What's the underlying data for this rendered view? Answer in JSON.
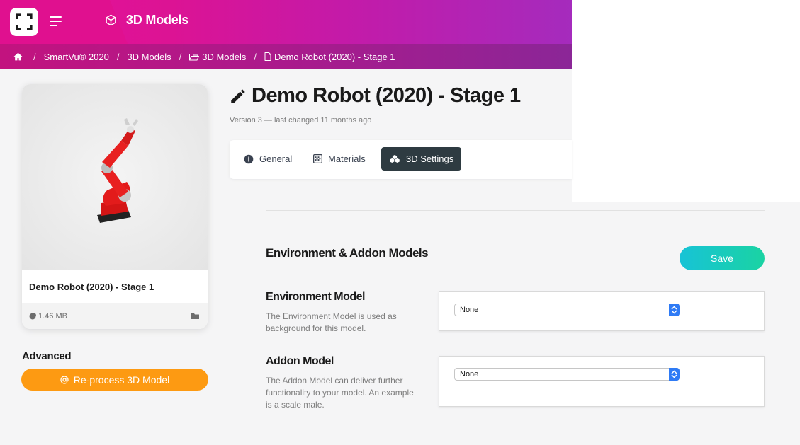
{
  "header": {
    "title": "3D Models",
    "logo_icon": "scan-frame-icon",
    "menu_icon": "hamburger-icon"
  },
  "breadcrumb": [
    {
      "label": "",
      "icon": "home-icon"
    },
    {
      "label": "SmartVu® 2020"
    },
    {
      "label": "3D Models"
    },
    {
      "label": "3D Models",
      "icon": "folder-open-icon"
    },
    {
      "label": "Demo Robot (2020) - Stage 1",
      "icon": "file-icon"
    }
  ],
  "card": {
    "name": "Demo Robot (2020) - Stage 1",
    "size": "1.46 MB"
  },
  "advanced": {
    "label": "Advanced",
    "reprocess_label": "Re-process 3D Model"
  },
  "page": {
    "title": "Demo Robot (2020) - Stage 1",
    "version": "Version 3 — last changed 11 months ago"
  },
  "tabs": [
    {
      "label": "General",
      "active": false
    },
    {
      "label": "Materials",
      "active": false
    },
    {
      "label": "3D Settings",
      "active": true
    }
  ],
  "section": {
    "title": "Environment & Addon Models",
    "save_label": "Save"
  },
  "fields": {
    "environment": {
      "title": "Environment Model",
      "description": "The Environment Model is used as background for this model.",
      "value": "None"
    },
    "addon": {
      "title": "Addon Model",
      "description": "The Addon Model can deliver further functionality to your model. An example is a scale male.",
      "value": "None"
    }
  },
  "colors": {
    "brand_pink": "#e0108f",
    "brand_purple": "#a52bbd",
    "orange": "#fd9a12",
    "save_gradient_start": "#17c3d6",
    "save_gradient_end": "#1ad3a3",
    "active_tab": "#2e3b41"
  }
}
